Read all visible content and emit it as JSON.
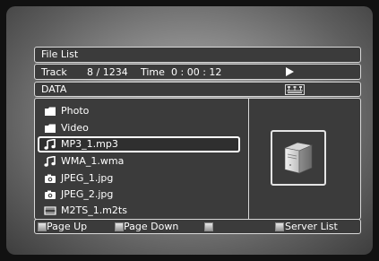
{
  "header": {
    "title": "File List",
    "track_label": "Track",
    "track_value": "8 / 1234",
    "time_label": "Time",
    "time_value": "0 : 00 : 12",
    "play_icon": "play-icon"
  },
  "source": {
    "label": "DATA",
    "indicator_icon": "network-connection-icon"
  },
  "file_list": {
    "items": [
      {
        "name": "Photo",
        "icon": "folder-icon"
      },
      {
        "name": "Video",
        "icon": "folder-icon"
      },
      {
        "name": "MP3_1.mp3",
        "icon": "music-note-icon",
        "selected": true
      },
      {
        "name": "WMA_1.wma",
        "icon": "music-note-icon"
      },
      {
        "name": "JPEG_1.jpg",
        "icon": "camera-icon"
      },
      {
        "name": "JPEG_2.jpg",
        "icon": "camera-icon"
      },
      {
        "name": "M2TS_1.m2ts",
        "icon": "video-file-icon"
      }
    ]
  },
  "preview": {
    "icon": "server-icon"
  },
  "footer": {
    "page_up": "Page Up",
    "page_down": "Page Down",
    "empty": "",
    "server_list": "Server List"
  }
}
